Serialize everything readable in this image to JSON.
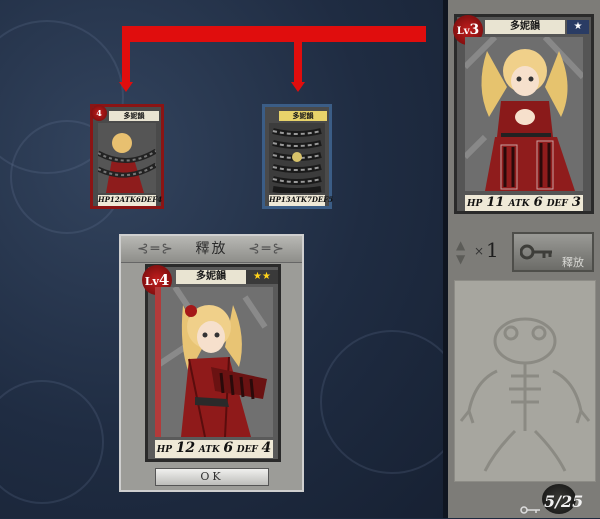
{
  "arrows": {
    "color": "#e00d0d"
  },
  "hero_card": {
    "lv_label": "Lv",
    "lv": "3",
    "name": "多妮韻",
    "stars": "★",
    "hp_label": "HP",
    "hp": "11",
    "atk_label": "ATK",
    "atk": "6",
    "def_label": "DEF",
    "def": "3"
  },
  "source_card": {
    "lv": "4",
    "name": "多妮韻",
    "hp_label": "HP",
    "hp": "12",
    "atk_label": "ATK",
    "atk": "6",
    "def_label": "DEF",
    "def": "4"
  },
  "target_card": {
    "name": "多妮韻",
    "hp_label": "HP",
    "hp": "13",
    "atk_label": "ATK",
    "atk": "7",
    "def_label": "DEF",
    "def": "5"
  },
  "release_panel": {
    "title": "釋放",
    "card": {
      "lv_label": "Lv",
      "lv": "4",
      "name": "多妮韻",
      "stars": "★★",
      "hp_label": "HP",
      "hp": "12",
      "atk_label": "ATK",
      "atk": "6",
      "def_label": "DEF",
      "def": "4"
    },
    "ok_label": "OK"
  },
  "sidebar": {
    "quantity_prefix": "×",
    "quantity": "1",
    "release_button_label": "釋放",
    "frog_icon": "frog-skeleton-icon"
  },
  "counter": {
    "value": "5/25",
    "icon": "key-icon"
  }
}
